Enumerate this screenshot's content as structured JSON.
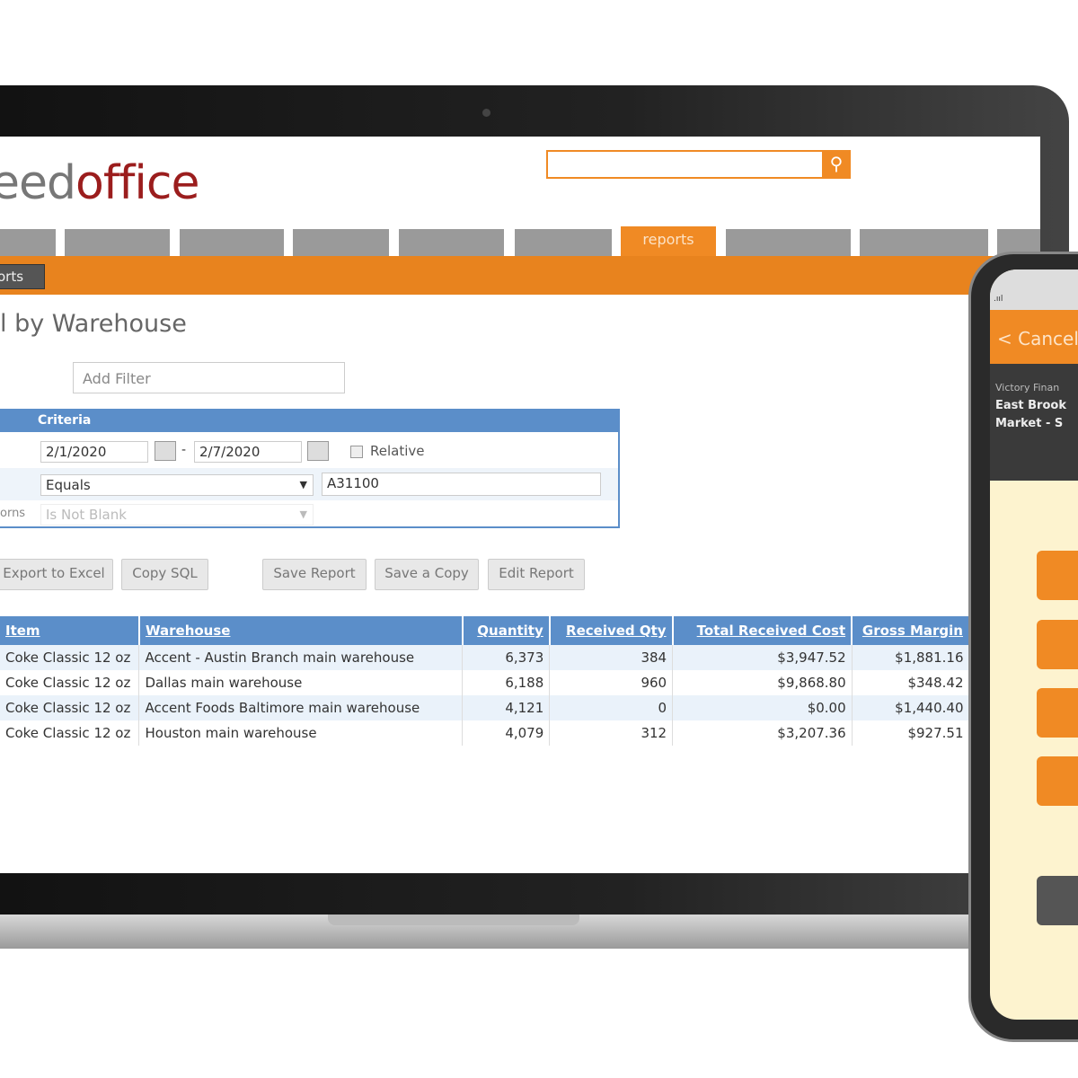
{
  "app": {
    "logo_partial_1": "eed",
    "logo_partial_2": "office",
    "search_placeholder": "",
    "active_tab": "reports",
    "breadcrumb": "orts",
    "page_title": "l by Warehouse",
    "add_filter_placeholder": "Add Filter"
  },
  "criteria": {
    "header": "Criteria",
    "date_from": "2/1/2020",
    "date_sep": "-",
    "date_to": "2/7/2020",
    "relative_label": "Relative",
    "operator": "Equals",
    "value": "A31100",
    "row3_label": "orns",
    "row3_operator": "Is Not Blank"
  },
  "buttons": {
    "export": "Export to Excel",
    "copy_sql": "Copy SQL",
    "save": "Save Report",
    "save_copy": "Save a Copy",
    "edit": "Edit Report"
  },
  "table": {
    "columns": [
      "Item",
      "Warehouse",
      "Quantity",
      "Received Qty",
      "Total Received Cost",
      "Gross Margin"
    ],
    "rows": [
      [
        "Coke Classic 12 oz",
        "Accent - Austin Branch main warehouse",
        "6,373",
        "384",
        "$3,947.52",
        "$1,881.16"
      ],
      [
        "Coke Classic 12 oz",
        "Dallas main warehouse",
        "6,188",
        "960",
        "$9,868.80",
        "$348.42"
      ],
      [
        "Coke Classic 12 oz",
        "Accent Foods Baltimore main warehouse",
        "4,121",
        "0",
        "$0.00",
        "$1,440.40"
      ],
      [
        "Coke Classic 12 oz",
        "Houston main warehouse",
        "4,079",
        "312",
        "$3,207.36",
        "$927.51"
      ]
    ]
  },
  "phone": {
    "cancel": "< Cancel",
    "line1": "Victory Finan",
    "line2": "East Brook",
    "line3": "Market - S"
  },
  "colors": {
    "accent": "#e8831e",
    "header_blue": "#5b8ec9",
    "logo_red": "#9b1d1d"
  }
}
